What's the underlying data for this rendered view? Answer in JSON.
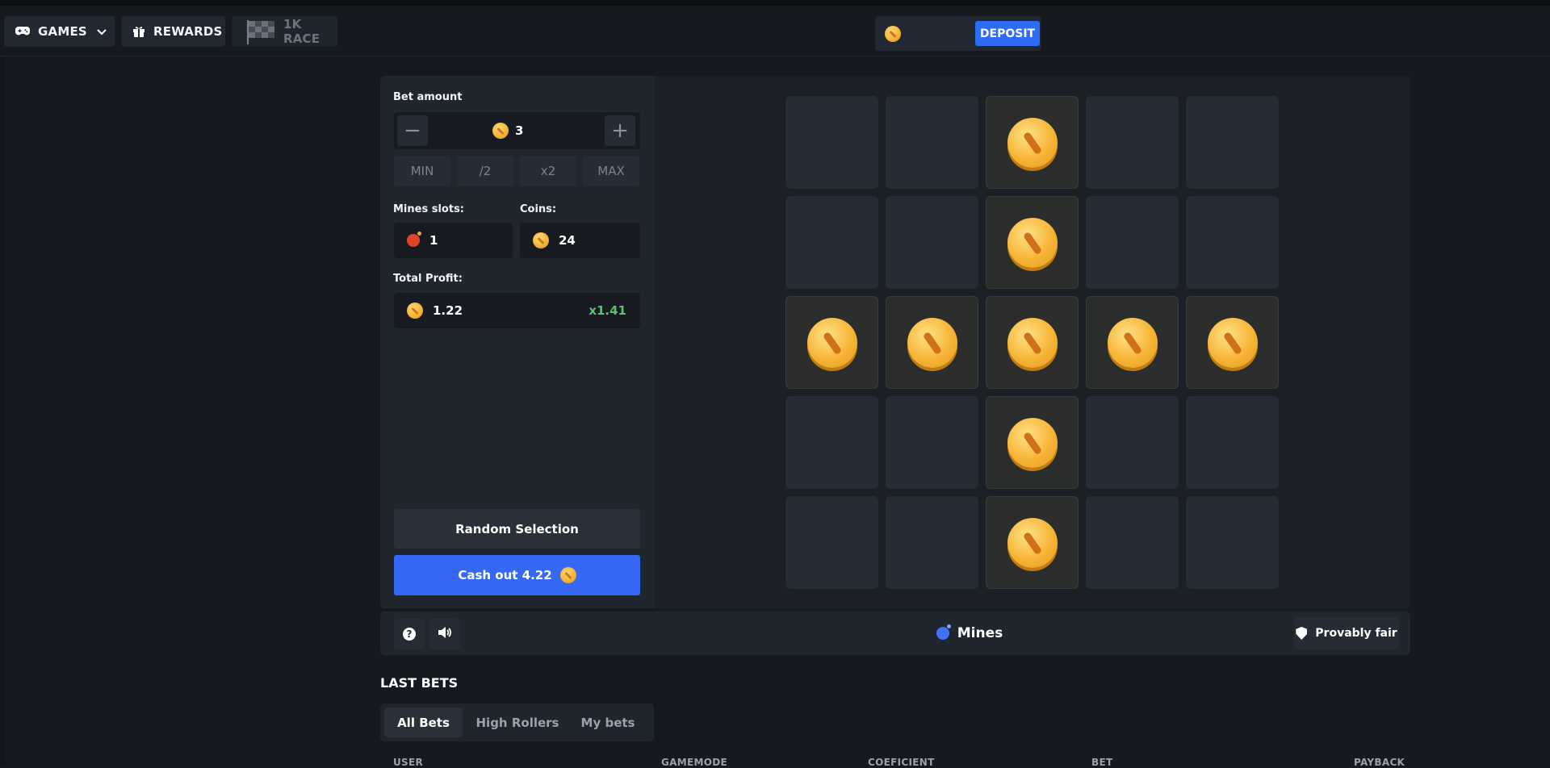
{
  "nav": {
    "games_label": "GAMES",
    "rewards_label": "REWARDS",
    "race_label": "1K RACE"
  },
  "wallet": {
    "balance": "",
    "deposit_label": "DEPOSIT"
  },
  "bet_panel": {
    "bet_amount_label": "Bet amount",
    "bet_value": "3",
    "decrease_symbol": "−",
    "increase_symbol": "+",
    "quick_buttons": [
      "MIN",
      "/2",
      "x2",
      "MAX"
    ],
    "mines_label": "Mines slots:",
    "mines_value": "1",
    "coins_label": "Coins:",
    "coins_value": "24",
    "profit_label": "Total Profit:",
    "profit_value": "1.22",
    "multiplier": "x1.41",
    "random_label": "Random Selection",
    "cashout_label": "Cash out 4.22"
  },
  "grid": {
    "rows": 5,
    "cols": 5,
    "revealed": [
      [
        false,
        false,
        true,
        false,
        false
      ],
      [
        false,
        false,
        true,
        false,
        false
      ],
      [
        true,
        true,
        true,
        true,
        true
      ],
      [
        false,
        false,
        true,
        false,
        false
      ],
      [
        false,
        false,
        true,
        false,
        false
      ]
    ]
  },
  "footer": {
    "game_title": "Mines",
    "provably_fair_label": "Provably fair"
  },
  "last_bets": {
    "title": "LAST BETS",
    "tabs": [
      "All Bets",
      "High Rollers",
      "My bets"
    ],
    "active_tab": 0,
    "columns": [
      "USER",
      "GAMEMODE",
      "COEFICIENT",
      "BET",
      "PAYBACK"
    ]
  },
  "colors": {
    "accent": "#3468f5",
    "multiplier": "#5ec26a",
    "coin": "#f5b133"
  }
}
